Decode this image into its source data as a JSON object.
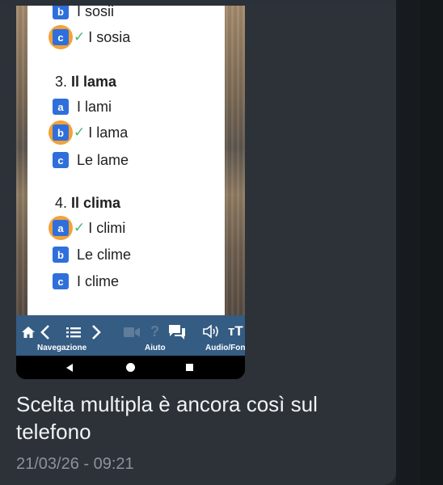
{
  "message": {
    "text": "Scelta multipla è ancora così sul telefono",
    "timestamp": "21/03/26 - 09:21"
  },
  "quiz": {
    "partial_row": {
      "letter": "b",
      "text": "I sosii"
    },
    "prev_answer": {
      "letter": "c",
      "text": "I sosia",
      "selected": true,
      "correct": true
    },
    "questions": [
      {
        "number": "3.",
        "title": "Il lama",
        "options": [
          {
            "letter": "a",
            "text": "I lami"
          },
          {
            "letter": "b",
            "text": "I lama",
            "selected": true,
            "correct": true
          },
          {
            "letter": "c",
            "text": "Le lame"
          }
        ]
      },
      {
        "number": "4.",
        "title": "Il clima",
        "options": [
          {
            "letter": "a",
            "text": "I climi",
            "selected": true,
            "correct": true
          },
          {
            "letter": "b",
            "text": "Le clime"
          },
          {
            "letter": "c",
            "text": "I clime"
          }
        ]
      }
    ],
    "check_glyph": "✓"
  },
  "toolbar": {
    "labels": {
      "navigation": "Navegazione",
      "help": "Aiuto",
      "audio": "Audio/Fon"
    },
    "icons": [
      "home-icon",
      "chevron-left-icon",
      "list-icon",
      "chevron-right-icon",
      "video-icon",
      "help-icon",
      "chat-icon",
      "speaker-icon",
      "text-size-icon"
    ],
    "help_glyph": "?",
    "text_size_glyph": "ᴛT"
  },
  "colors": {
    "badge": "#2f6fdb",
    "selected_ring": "#f2a23a",
    "check": "#4cb56f",
    "navbar": "#355c83"
  }
}
